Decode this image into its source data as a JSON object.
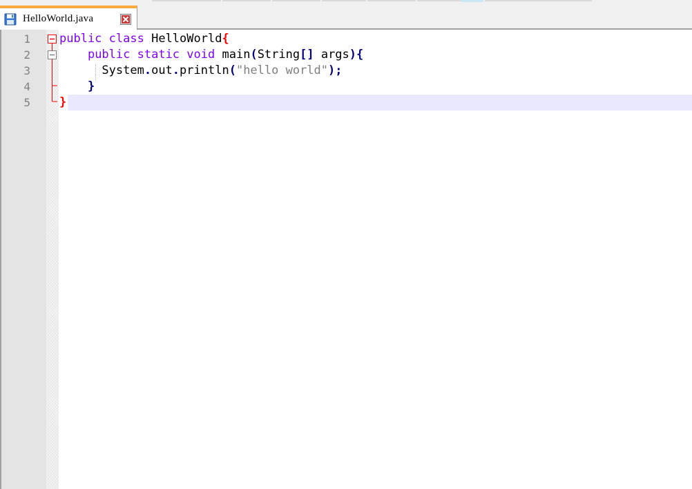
{
  "tab": {
    "filename": "HelloWorld.java",
    "save_icon": "save-icon",
    "close_icon": "close-icon"
  },
  "editor": {
    "line_numbers": [
      "1",
      "2",
      "3",
      "4",
      "5"
    ],
    "lines": [
      {
        "tokens": [
          [
            "kw",
            "public"
          ],
          [
            "id",
            " "
          ],
          [
            "kw",
            "class"
          ],
          [
            "id",
            " HelloWorld"
          ],
          [
            "brace-hl",
            "{"
          ]
        ]
      },
      {
        "tokens": [
          [
            "id",
            "    "
          ],
          [
            "kw",
            "public"
          ],
          [
            "id",
            " "
          ],
          [
            "kw",
            "static"
          ],
          [
            "id",
            " "
          ],
          [
            "kw",
            "void"
          ],
          [
            "id",
            " main"
          ],
          [
            "op",
            "("
          ],
          [
            "id",
            "String"
          ],
          [
            "op",
            "[]"
          ],
          [
            "id",
            " args"
          ],
          [
            "op",
            "){"
          ]
        ]
      },
      {
        "tokens": [
          [
            "id",
            "      System"
          ],
          [
            "op",
            "."
          ],
          [
            "id",
            "out"
          ],
          [
            "op",
            "."
          ],
          [
            "id",
            "println"
          ],
          [
            "op",
            "("
          ],
          [
            "str",
            "\"hello world\""
          ],
          [
            "op",
            ");"
          ]
        ]
      },
      {
        "tokens": [
          [
            "id",
            "    "
          ],
          [
            "op",
            "}"
          ]
        ]
      },
      {
        "tokens": [
          [
            "brace-hl",
            "}"
          ]
        ]
      }
    ],
    "colors": {
      "keyword": "#8000ff",
      "operator": "#000080",
      "string": "#808080",
      "brace_highlight": "#ff0000",
      "current_line": "#e8e8ff",
      "active_tab_accent": "#fba93c"
    }
  }
}
